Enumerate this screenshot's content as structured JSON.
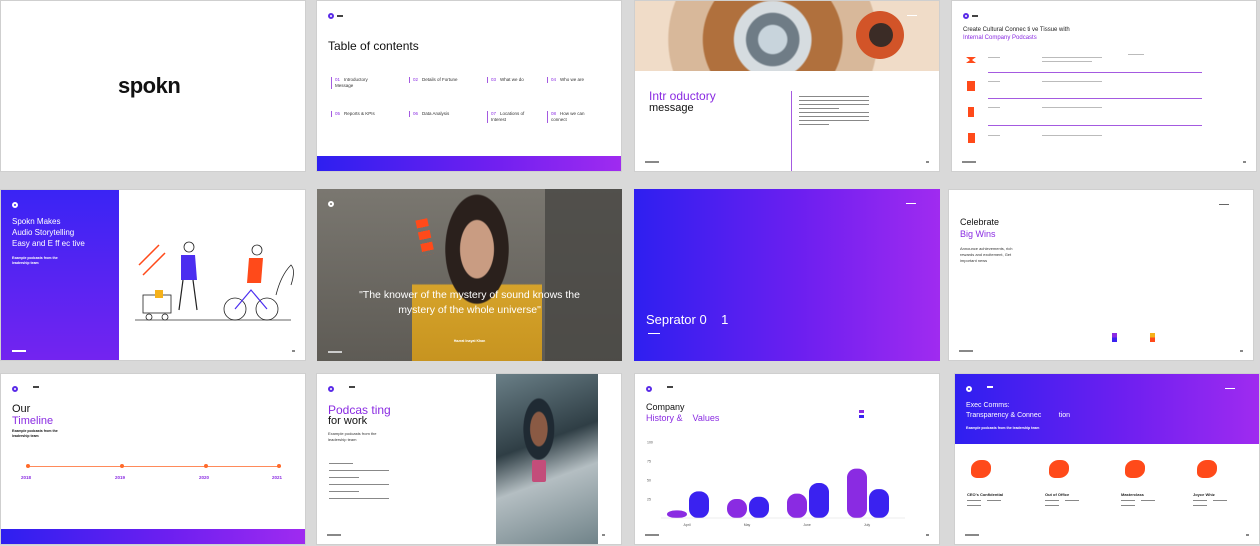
{
  "logo": {
    "text": "spokn"
  },
  "toc": {
    "title": "Table of contents",
    "items": [
      {
        "num": "01",
        "label": "Introductory Message"
      },
      {
        "num": "02",
        "label": "Details of Fortune"
      },
      {
        "num": "03",
        "label": "What we do"
      },
      {
        "num": "04",
        "label": "Who we are"
      },
      {
        "num": "05",
        "label": "Reports & KPIs"
      },
      {
        "num": "06",
        "label": "Data Analysis"
      },
      {
        "num": "07",
        "label": "Locations of Interest"
      },
      {
        "num": "08",
        "label": "How we can connect"
      }
    ]
  },
  "intro": {
    "line1": "Intr oductory",
    "line2": "message"
  },
  "culture": {
    "line1": "Create Cultural Connec    ti ve Tissue with",
    "line2": "Internal Company Podcasts"
  },
  "makes": {
    "line1": "Spokn Makes",
    "line2": "Audio Storytelling",
    "line3": "Easy and E    ff ec tive",
    "sub": "Example podcasts from the leadership team"
  },
  "quote": {
    "text": "\"The knower of the mystery of sound knows the mystery of the whole universe\"",
    "author": "Hazrat Inayat Khan"
  },
  "separator": {
    "title": "Seprator 0    1"
  },
  "celebrate": {
    "line1": "Celebrate",
    "line2": "Big Wins",
    "sub": "Announce achievements, rich rewards and excitement, Get important news"
  },
  "timeline": {
    "line1": "Our",
    "line2": "Timeline",
    "sub": "Example podcasts from the leadership team",
    "years": [
      "2018",
      "2019",
      "2020",
      "2021"
    ]
  },
  "podcasting": {
    "line1": "Podcas ting",
    "line2": "for work",
    "sub": "Example podcasts from the leadership team"
  },
  "company": {
    "line1": "Company",
    "line2": "History &    Values"
  },
  "exec": {
    "line1": "Exec Comms:",
    "line2": "Transparency & Connec         tion",
    "sub": "Example podcasts from the leadership team",
    "labels": [
      "CEO's Confidential",
      "Out of Office",
      "Masterclass",
      "Joyce Whiz"
    ]
  },
  "colors": {
    "accent": "#8a2be2",
    "blue": "#3a22f0",
    "orange": "#ff4a1a"
  },
  "chart_data": {
    "type": "bar",
    "categories": [
      "April",
      "May",
      "June",
      "July"
    ],
    "series": [
      {
        "values": [
          10,
          25,
          32,
          65
        ]
      },
      {
        "values": [
          35,
          28,
          46,
          38
        ]
      }
    ],
    "yticks": [
      "100",
      "75",
      "50",
      "25"
    ],
    "ylim": [
      0,
      100
    ]
  }
}
